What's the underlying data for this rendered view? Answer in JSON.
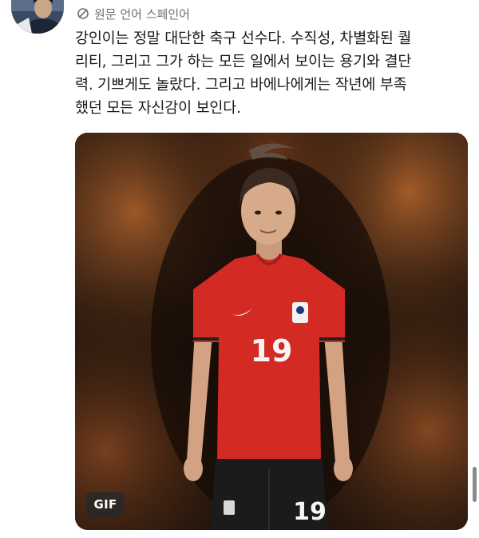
{
  "tweet": {
    "translation_label": "원문 언어 스페인어",
    "text": "강인이는 정말 대단한 축구 선수다. 수직성, 차별화된 퀄\n리티, 그리고 그가 하는 모든 일에서 보이는 용기와 결단\n력. 기쁘게도 놀랐다. 그리고 바에나에게는 작년에 부족\n했던 모든 자신감이 보인다.",
    "media": {
      "badge": "GIF",
      "jersey_number": "19",
      "shorts_number": "19"
    }
  },
  "icons": {
    "translate": "translate-icon"
  },
  "colors": {
    "jersey_red": "#d42a24",
    "background_dark": "#1e120b",
    "fire_orange": "#b8682f"
  }
}
